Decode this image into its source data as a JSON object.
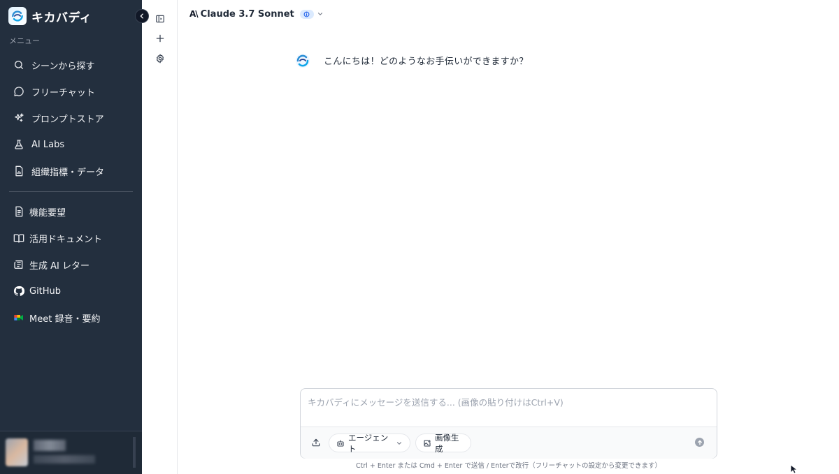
{
  "app": {
    "name": "キカバディ"
  },
  "sidebar": {
    "menu_heading": "メニュー",
    "items": [
      {
        "label": "シーンから探す",
        "icon": "search-icon"
      },
      {
        "label": "フリーチャット",
        "icon": "chat-bubble-icon"
      },
      {
        "label": "プロンプトストア",
        "icon": "sparkles-icon"
      },
      {
        "label": "AI Labs",
        "icon": "flask-icon"
      },
      {
        "label": "組織指標・データ",
        "icon": "chart-document-icon"
      }
    ],
    "secondary_items": [
      {
        "label": "機能要望",
        "icon": "document-icon"
      },
      {
        "label": "活用ドキュメント",
        "icon": "book-open-icon"
      },
      {
        "label": "生成 AI レター",
        "icon": "newspaper-icon"
      },
      {
        "label": "GitHub",
        "icon": "github-icon"
      },
      {
        "label": "Meet 録音・要約",
        "icon": "google-meet-icon"
      }
    ]
  },
  "header": {
    "model_name": "Claude 3.7 Sonnet",
    "provider_mark": "A\\"
  },
  "chat": {
    "messages": [
      {
        "role": "assistant",
        "text": "こんにちは！どのようなお手伝いができますか？"
      }
    ]
  },
  "composer": {
    "placeholder": "キカバディにメッセージを送信する... (画像の貼り付けはCtrl+V)",
    "value": "",
    "agent_label": "エージェント",
    "image_gen_label": "画像生成",
    "hint": "Ctrl + Enter または Cmd + Enter で送信 / Enterで改行（フリーチャットの設定から変更できます）"
  },
  "colors": {
    "sidebar_bg": "#232f3e",
    "accent_blue": "#2b8fd6"
  }
}
